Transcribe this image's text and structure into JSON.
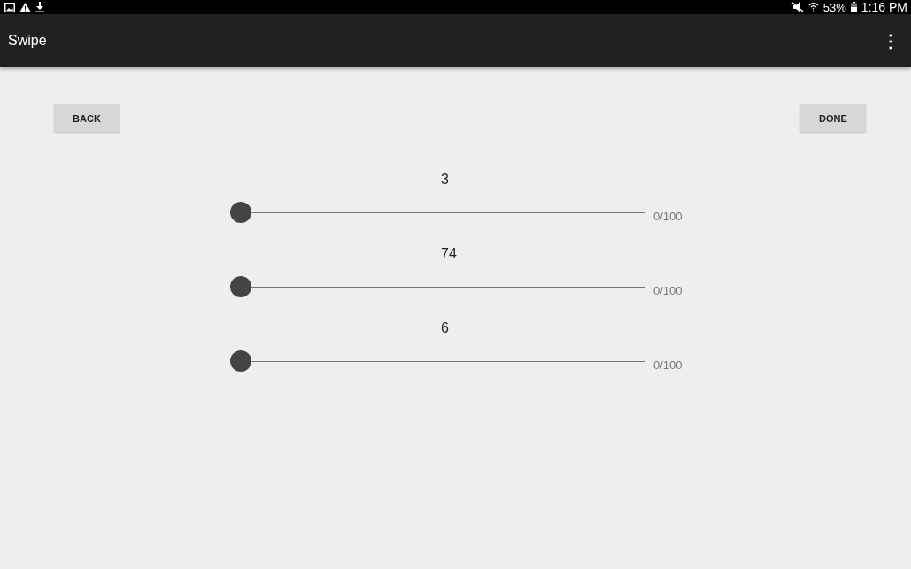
{
  "status_bar": {
    "battery": "53%",
    "time": "1:16 PM"
  },
  "app_bar": {
    "title": "Swipe",
    "menu": "⋮"
  },
  "buttons": [
    {
      "label": "BACK"
    },
    {
      "label": "DONE"
    }
  ],
  "sliders": [
    {
      "value": "3",
      "level": 0,
      "reading": "0/100"
    },
    {
      "value": "74",
      "level": 0,
      "reading": "0/100"
    },
    {
      "value": "6",
      "level": 0,
      "reading": "0/100"
    }
  ]
}
